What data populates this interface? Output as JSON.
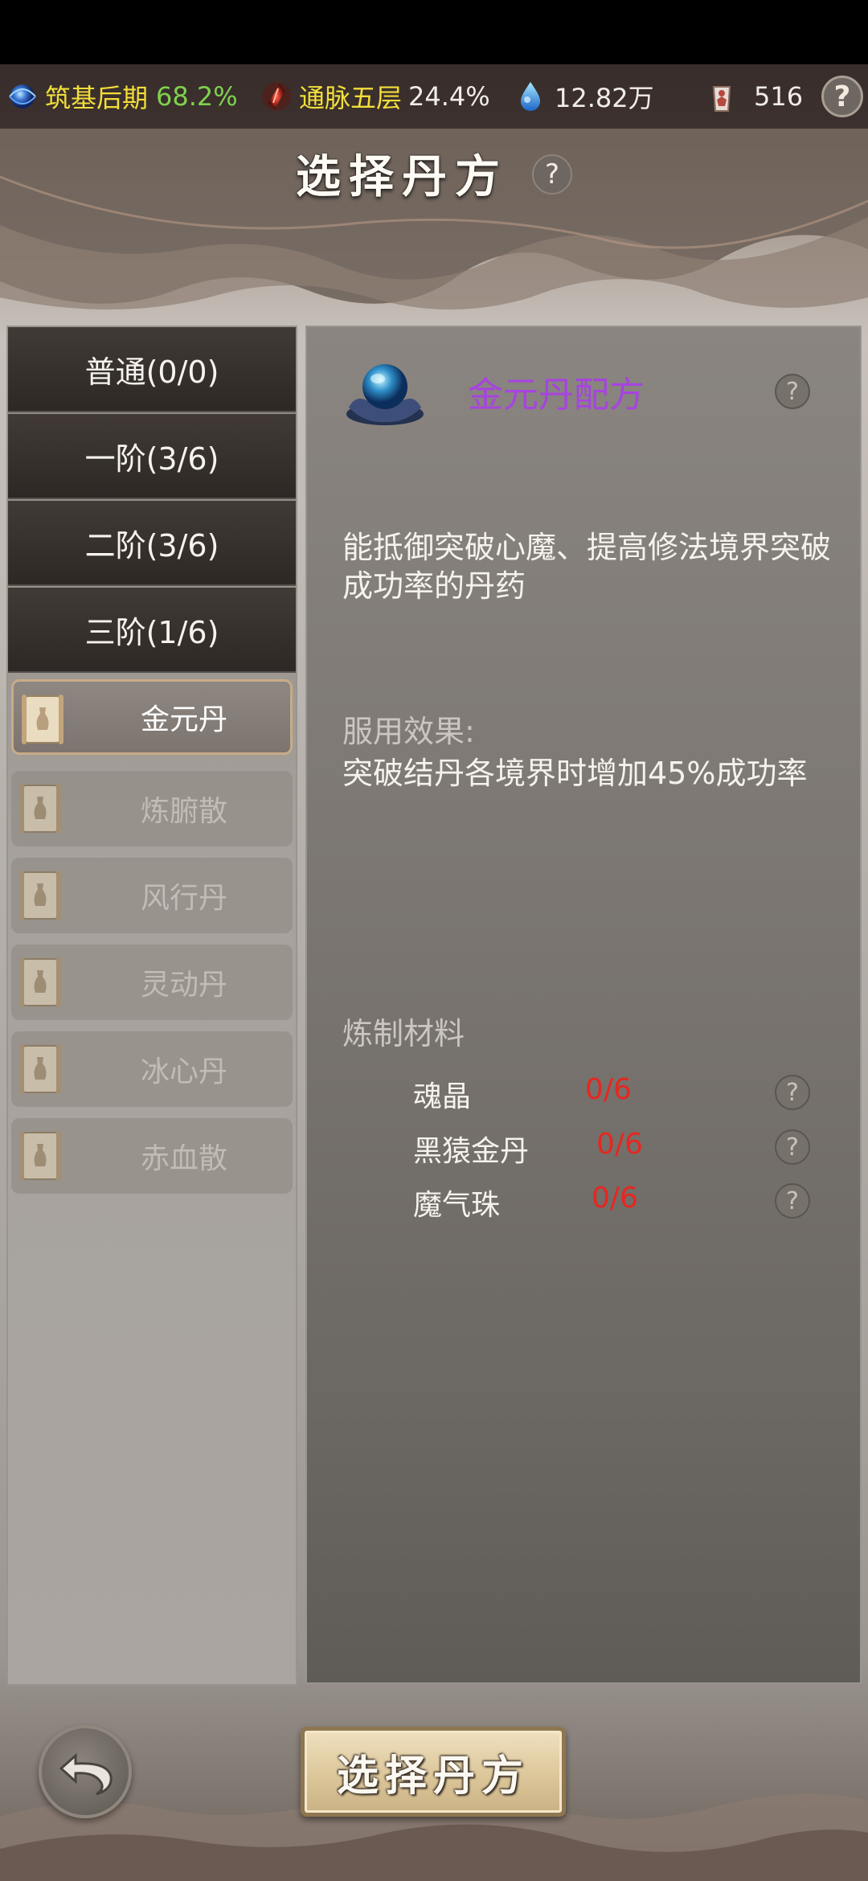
{
  "status_bar": {
    "realm_label": "筑基后期",
    "realm_progress": "68.2%",
    "meridian_label": "通脉五层",
    "meridian_progress": "24.4%",
    "spirit_stones": "12.82万",
    "token_count": "516",
    "help": "?"
  },
  "header": {
    "title": "选择丹方",
    "help": "?"
  },
  "tiers": [
    {
      "label": "普通(0/0)"
    },
    {
      "label": "一阶(3/6)"
    },
    {
      "label": "二阶(3/6)"
    },
    {
      "label": "三阶(1/6)"
    }
  ],
  "recipes": [
    {
      "label": "金元丹",
      "selected": true
    },
    {
      "label": "炼腑散",
      "selected": false
    },
    {
      "label": "风行丹",
      "selected": false
    },
    {
      "label": "灵动丹",
      "selected": false
    },
    {
      "label": "冰心丹",
      "selected": false
    },
    {
      "label": "赤血散",
      "selected": false
    }
  ],
  "detail": {
    "title": "金元丹配方",
    "help": "?",
    "description": "能抵御突破心魔、提高修法境界突破成功率的丹药",
    "effect_label": "服用效果:",
    "effect_text": "突破结丹各境界时增加45%成功率",
    "materials_label": "炼制材料",
    "materials": [
      {
        "name": "魂晶",
        "count": "0/6",
        "help": "?"
      },
      {
        "name": "黑猿金丹",
        "count": "0/6",
        "help": "?"
      },
      {
        "name": "魔气珠",
        "count": "0/6",
        "help": "?"
      }
    ]
  },
  "footer": {
    "confirm_label": "选择丹方"
  },
  "colors": {
    "recipe_title": "#a744df",
    "material_count": "#e8261f",
    "realm_label": "#f2de3a",
    "realm_progress": "#7ed24f"
  },
  "icons": [
    "spirit-orb-icon",
    "blood-crystal-icon",
    "water-drop-icon",
    "figure-token-icon",
    "scroll-icon",
    "lotus-orb-icon",
    "back-arrow-icon"
  ]
}
